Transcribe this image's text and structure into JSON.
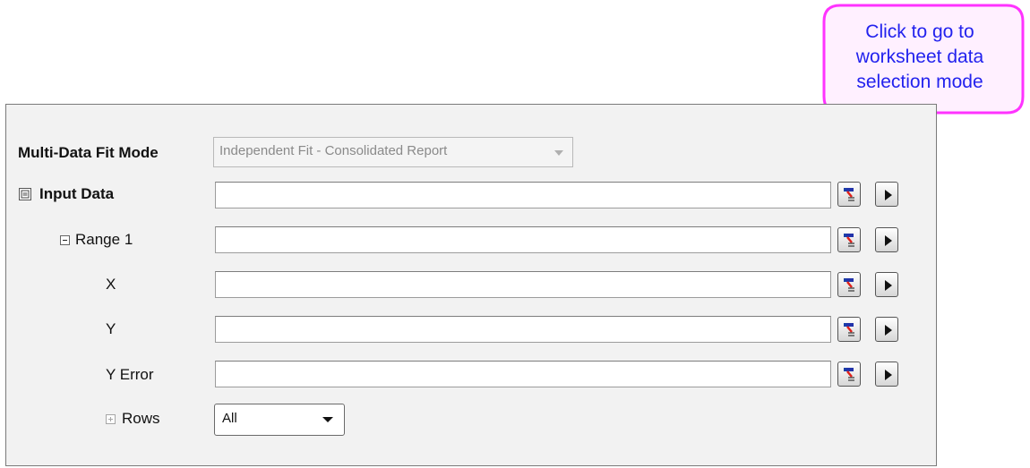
{
  "callout": {
    "text_lines": [
      "Click to go to",
      "worksheet data",
      "selection mode"
    ]
  },
  "fit_mode": {
    "label": "Multi-Data Fit Mode",
    "value": "Independent Fit - Consolidated Report"
  },
  "input_data": {
    "label": "Input Data"
  },
  "range": {
    "label": "Range 1"
  },
  "fields": {
    "x_label": "X",
    "y_label": "Y",
    "yerror_label": "Y Error"
  },
  "rows": {
    "label": "Rows",
    "value": "All"
  },
  "colors": {
    "callout_border": "#ff33ff",
    "callout_text": "#2222ee",
    "panel_bg": "#f2f2f2"
  },
  "icons": {
    "select_button": "worksheet-select-icon",
    "menu_button": "play-arrow-icon"
  }
}
